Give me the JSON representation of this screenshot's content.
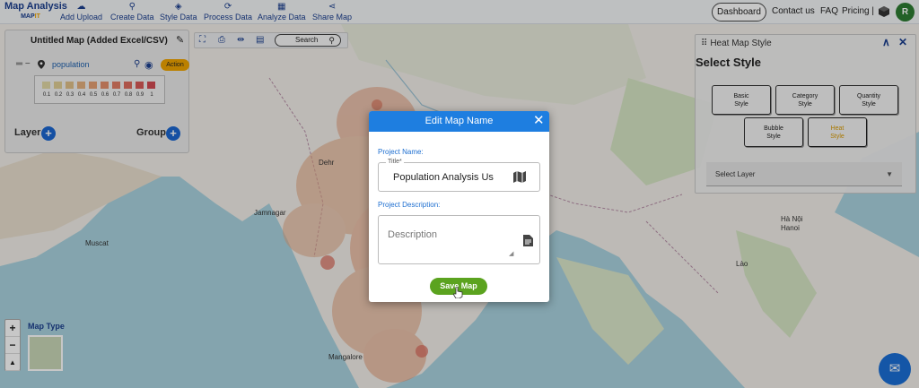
{
  "app": {
    "logo_line1": "Map Analysis",
    "logo_line2a": "MAP",
    "logo_line2b": "IT"
  },
  "nav": [
    {
      "label": "Add Upload",
      "icon": "cloud-upload-icon"
    },
    {
      "label": "Create Data",
      "icon": "map-pin-icon"
    },
    {
      "label": "Style Data",
      "icon": "paint-bucket-icon"
    },
    {
      "label": "Process Data",
      "icon": "process-icon"
    },
    {
      "label": "Analyze Data",
      "icon": "chart-icon"
    },
    {
      "label": "Share Map",
      "icon": "share-icon"
    }
  ],
  "header_right": {
    "dashboard": "Dashboard",
    "contact": "Contact us",
    "faq": "FAQ",
    "pricing": "Pricing |",
    "avatar_initial": "R"
  },
  "layer_panel": {
    "title": "Untitled Map (Added Excel/CSV)",
    "layer_name": "population",
    "action_label": "Action",
    "legend_values": [
      "0.1",
      "0.2",
      "0.3",
      "0.4",
      "0.5",
      "0.6",
      "0.7",
      "0.8",
      "0.9",
      "1"
    ],
    "legend_colors": [
      "#e2d9a6",
      "#e0cf96",
      "#e0c189",
      "#e4b07e",
      "#e6a074",
      "#e58f6b",
      "#e27d64",
      "#de6c5e",
      "#d85a58",
      "#d24b52"
    ],
    "layer_label": "Layer",
    "group_label": "Group"
  },
  "map_toolbar": {
    "search_label": "Search"
  },
  "style_panel": {
    "header": "Heat Map Style",
    "title": "Select Style",
    "styles": [
      {
        "line1": "Basic",
        "line2": "Style"
      },
      {
        "line1": "Category",
        "line2": "Style"
      },
      {
        "line1": "Quantity",
        "line2": "Style"
      },
      {
        "line1": "Bubble",
        "line2": "Style"
      },
      {
        "line1": "Heat",
        "line2": "Style"
      }
    ],
    "active_style": "Heat",
    "select_layer": "Select Layer"
  },
  "map_controls": {
    "zoom_in": "+",
    "zoom_out": "−",
    "map_type_label": "Map Type"
  },
  "map_labels": [
    "Jamnagar",
    "Mangalore",
    "Hà Nội",
    "Hanoi",
    "Lào",
    "Dehr",
    "Muscat"
  ],
  "modal": {
    "title": "Edit Map Name",
    "project_name_label": "Project Name:",
    "title_field_label": "Title*",
    "title_value": "Population Analysis Us",
    "project_desc_label": "Project Description:",
    "desc_placeholder": "Description",
    "save_label": "Save Map"
  }
}
